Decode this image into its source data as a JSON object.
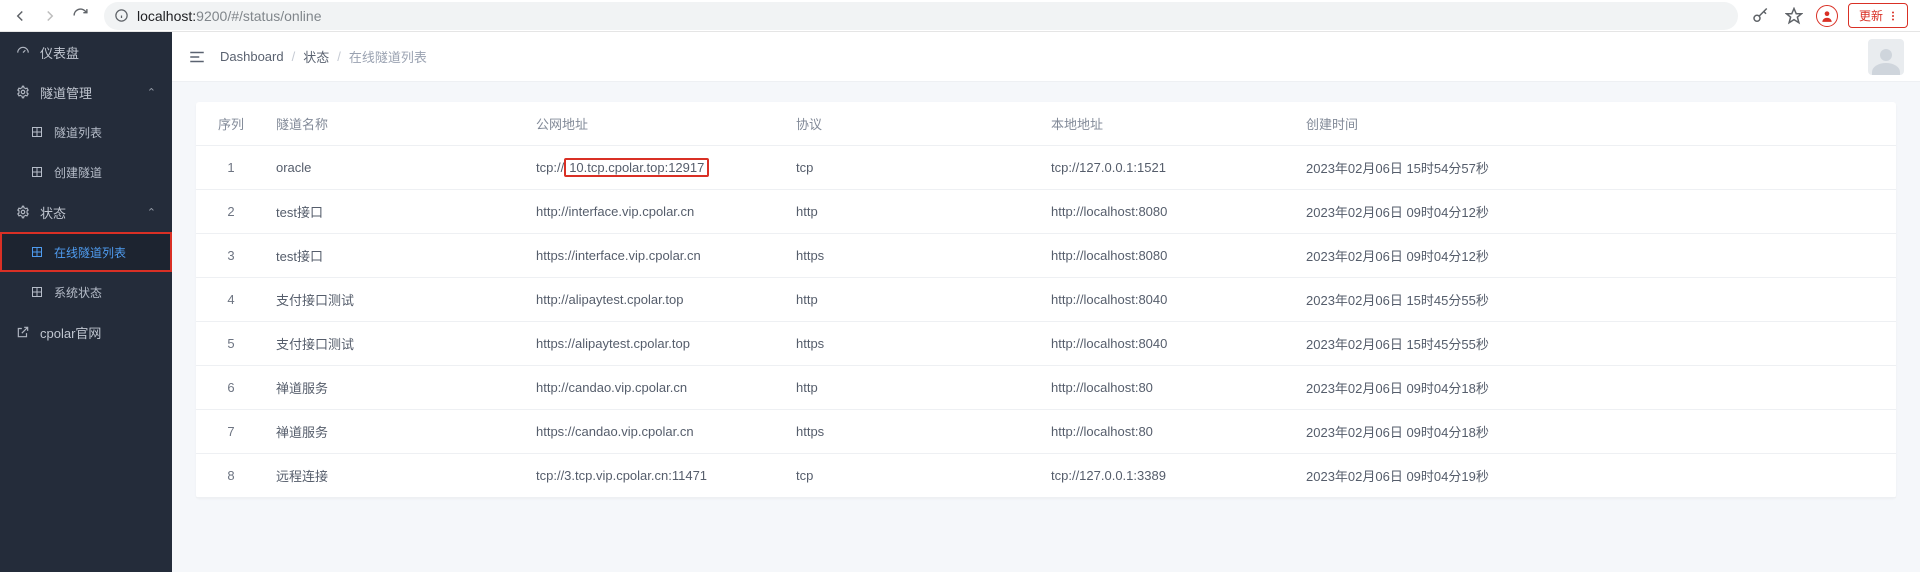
{
  "chrome": {
    "url_host": "localhost:",
    "url_port": "9200",
    "url_path": "/#/status/online",
    "update_label": "更新"
  },
  "sidebar": {
    "dashboard": "仪表盘",
    "tunnel_mgmt": "隧道管理",
    "tunnel_list": "隧道列表",
    "tunnel_create": "创建隧道",
    "status": "状态",
    "status_online": "在线隧道列表",
    "status_system": "系统状态",
    "official": "cpolar官网"
  },
  "breadcrumb": {
    "b1": "Dashboard",
    "b2": "状态",
    "b3": "在线隧道列表"
  },
  "table": {
    "headers": {
      "idx": "序列",
      "name": "隧道名称",
      "public": "公网地址",
      "proto": "协议",
      "local": "本地地址",
      "time": "创建时间"
    },
    "rows": [
      {
        "idx": "1",
        "name": "oracle",
        "pub_prefix": "tcp://",
        "pub_highlight": "10.tcp.cpolar.top:12917",
        "proto": "tcp",
        "local": "tcp://127.0.0.1:1521",
        "time": "2023年02月06日 15时54分57秒"
      },
      {
        "idx": "2",
        "name": "test接口",
        "pub": "http://interface.vip.cpolar.cn",
        "proto": "http",
        "local": "http://localhost:8080",
        "time": "2023年02月06日 09时04分12秒"
      },
      {
        "idx": "3",
        "name": "test接口",
        "pub": "https://interface.vip.cpolar.cn",
        "proto": "https",
        "local": "http://localhost:8080",
        "time": "2023年02月06日 09时04分12秒"
      },
      {
        "idx": "4",
        "name": "支付接口测试",
        "pub": "http://alipaytest.cpolar.top",
        "proto": "http",
        "local": "http://localhost:8040",
        "time": "2023年02月06日 15时45分55秒"
      },
      {
        "idx": "5",
        "name": "支付接口测试",
        "pub": "https://alipaytest.cpolar.top",
        "proto": "https",
        "local": "http://localhost:8040",
        "time": "2023年02月06日 15时45分55秒"
      },
      {
        "idx": "6",
        "name": "禅道服务",
        "pub": "http://candao.vip.cpolar.cn",
        "proto": "http",
        "local": "http://localhost:80",
        "time": "2023年02月06日 09时04分18秒"
      },
      {
        "idx": "7",
        "name": "禅道服务",
        "pub": "https://candao.vip.cpolar.cn",
        "proto": "https",
        "local": "http://localhost:80",
        "time": "2023年02月06日 09时04分18秒"
      },
      {
        "idx": "8",
        "name": "远程连接",
        "pub": "tcp://3.tcp.vip.cpolar.cn:11471",
        "proto": "tcp",
        "local": "tcp://127.0.0.1:3389",
        "time": "2023年02月06日 09时04分19秒"
      }
    ]
  }
}
